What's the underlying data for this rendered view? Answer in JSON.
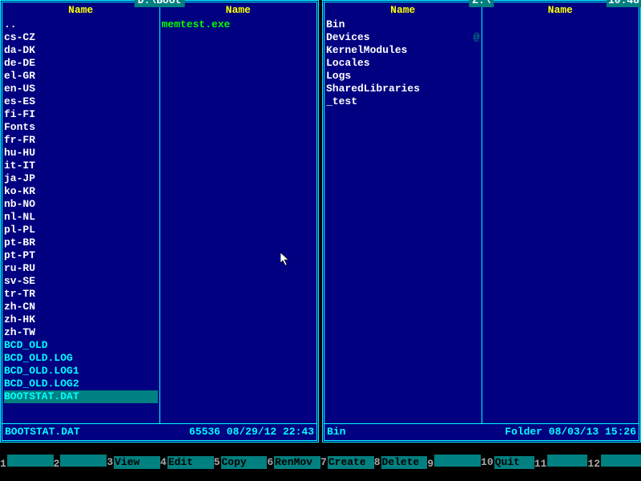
{
  "clock": "10:48",
  "panels": {
    "left": {
      "title": "D:\\Boot",
      "columns": [
        "Name",
        "Name"
      ],
      "col1": [
        {
          "n": "..",
          "t": "dir"
        },
        {
          "n": "cs-CZ",
          "t": "dir"
        },
        {
          "n": "da-DK",
          "t": "dir"
        },
        {
          "n": "de-DE",
          "t": "dir"
        },
        {
          "n": "el-GR",
          "t": "dir"
        },
        {
          "n": "en-US",
          "t": "dir"
        },
        {
          "n": "es-ES",
          "t": "dir"
        },
        {
          "n": "fi-FI",
          "t": "dir"
        },
        {
          "n": "Fonts",
          "t": "dir"
        },
        {
          "n": "fr-FR",
          "t": "dir"
        },
        {
          "n": "hu-HU",
          "t": "dir"
        },
        {
          "n": "it-IT",
          "t": "dir"
        },
        {
          "n": "ja-JP",
          "t": "dir"
        },
        {
          "n": "ko-KR",
          "t": "dir"
        },
        {
          "n": "nb-NO",
          "t": "dir"
        },
        {
          "n": "nl-NL",
          "t": "dir"
        },
        {
          "n": "pl-PL",
          "t": "dir"
        },
        {
          "n": "pt-BR",
          "t": "dir"
        },
        {
          "n": "pt-PT",
          "t": "dir"
        },
        {
          "n": "ru-RU",
          "t": "dir"
        },
        {
          "n": "sv-SE",
          "t": "dir"
        },
        {
          "n": "tr-TR",
          "t": "dir"
        },
        {
          "n": "zh-CN",
          "t": "dir"
        },
        {
          "n": "zh-HK",
          "t": "dir"
        },
        {
          "n": "zh-TW",
          "t": "dir"
        },
        {
          "n": "BCD_OLD",
          "t": "file"
        },
        {
          "n": "BCD_OLD.LOG",
          "t": "file"
        },
        {
          "n": "BCD_OLD.LOG1",
          "t": "file"
        },
        {
          "n": "BCD_OLD.LOG2",
          "t": "file"
        },
        {
          "n": "BOOTSTAT.DAT",
          "t": "file",
          "sel": true
        }
      ],
      "col2": [
        {
          "n": "memtest.exe",
          "t": "exe"
        }
      ],
      "status": {
        "name": "BOOTSTAT.DAT",
        "meta": "65536 08/29/12 22:43"
      }
    },
    "right": {
      "title": "Z:\\",
      "columns": [
        "Name",
        "Name"
      ],
      "col1": [
        {
          "n": "Bin",
          "t": "dir"
        },
        {
          "n": "Devices",
          "t": "dir",
          "mark": true
        },
        {
          "n": "KernelModules",
          "t": "dir"
        },
        {
          "n": "Locales",
          "t": "dir"
        },
        {
          "n": "Logs",
          "t": "dir"
        },
        {
          "n": "SharedLibraries",
          "t": "dir"
        },
        {
          "n": "_test",
          "t": "dir"
        }
      ],
      "col2": [],
      "status": {
        "name": "Bin",
        "meta": "Folder 08/03/13 15:26"
      }
    }
  },
  "fkeys": [
    {
      "num": "1",
      "label": ""
    },
    {
      "num": "2",
      "label": ""
    },
    {
      "num": "3",
      "label": "View"
    },
    {
      "num": "4",
      "label": "Edit"
    },
    {
      "num": "5",
      "label": "Copy"
    },
    {
      "num": "6",
      "label": "RenMov"
    },
    {
      "num": "7",
      "label": "Create"
    },
    {
      "num": "8",
      "label": "Delete"
    },
    {
      "num": "9",
      "label": ""
    },
    {
      "num": "10",
      "label": "Quit"
    },
    {
      "num": "11",
      "label": ""
    },
    {
      "num": "12",
      "label": ""
    }
  ]
}
